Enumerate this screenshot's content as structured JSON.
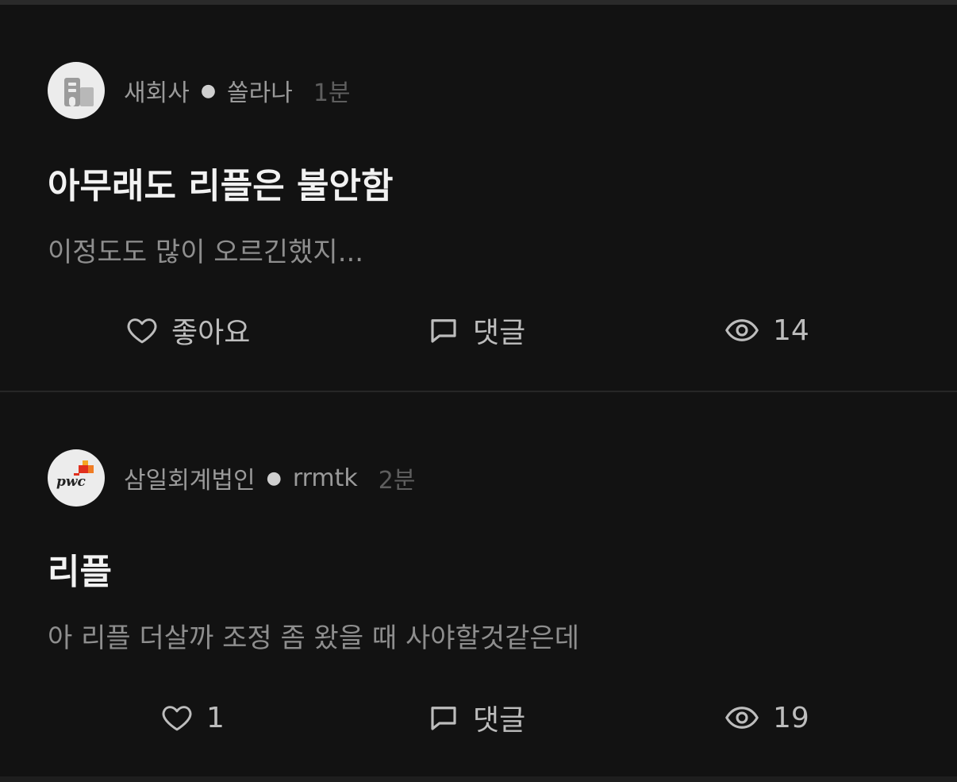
{
  "posts": [
    {
      "company": "새회사",
      "author": "쏠라나",
      "time": "1분",
      "avatar_icon": "building-icon",
      "title": "아무래도 리플은 불안함",
      "snippet": "이정도도 많이 오르긴했지...",
      "actions": {
        "like": "좋아요",
        "comment": "댓글",
        "views": "14"
      }
    },
    {
      "company": "삼일회계법인",
      "author": "rrmtk",
      "time": "2분",
      "avatar_icon": "pwc-logo",
      "avatar_logo_text": "pwc",
      "title": "리플",
      "snippet": "아 리플 더살까 조정 좀 왔을 때 사야할것같은데",
      "actions": {
        "like": "1",
        "comment": "댓글",
        "views": "19"
      }
    }
  ],
  "colors": {
    "background": "#121212",
    "title": "#f2f2f2",
    "meta": "#9a9a9a",
    "time": "#5e5e5e",
    "action": "#bdbdbd",
    "pwc_orange": "#e0301e"
  }
}
